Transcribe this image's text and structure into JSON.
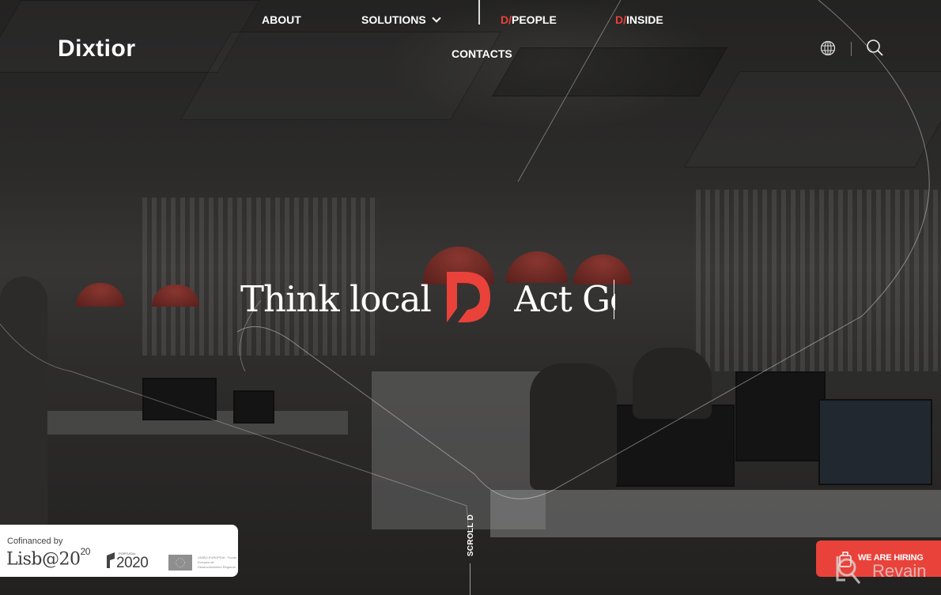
{
  "brand": {
    "logo_text": "Dixtior"
  },
  "nav": {
    "items": [
      {
        "label": "ABOUT"
      },
      {
        "label": "SOLUTIONS",
        "has_dropdown": true
      },
      {
        "prefix": "D/",
        "label": "PEOPLE"
      },
      {
        "prefix": "D/",
        "label": "INSIDE"
      },
      {
        "label": "CONTACTS"
      }
    ],
    "language_icon": "globe-icon",
    "search_icon": "search-icon"
  },
  "hero": {
    "tagline_left": "Think local",
    "tagline_right": "Act Go",
    "mark_icon": "d-logo-mark",
    "scroll_label": "SCROLL D"
  },
  "cofinanced": {
    "label": "Cofinanced by",
    "logos": [
      {
        "name": "Lisb@20",
        "suffix": "20"
      },
      {
        "name": "2020",
        "small": "PORTUGAL"
      },
      {
        "name": "União Europeia",
        "text": "UNIÃO EUROPEIA · Fundo Europeu de Desenvolvimento Regional"
      }
    ]
  },
  "cta": {
    "hiring_label": "WE ARE HIRING"
  },
  "watermark": {
    "text": "Revain"
  },
  "colors": {
    "accent": "#e8423a",
    "text": "#ffffff"
  }
}
